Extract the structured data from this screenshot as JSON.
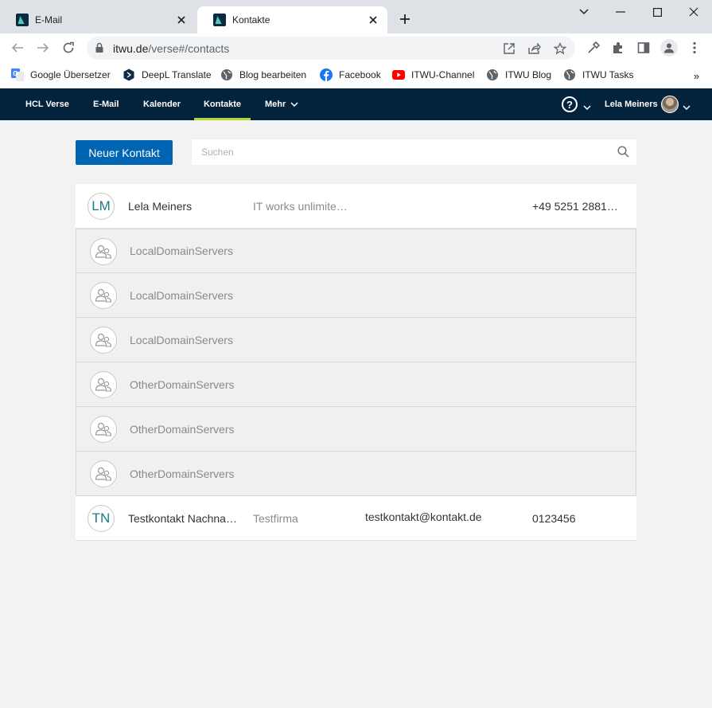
{
  "browser": {
    "tabs": [
      {
        "title": "E-Mail",
        "icon": "verse-favicon-icon",
        "active": false
      },
      {
        "title": "Kontakte",
        "icon": "verse-favicon-icon",
        "active": true
      }
    ],
    "url_host": "itwu.de",
    "url_path": "/verse#/contacts",
    "bookmarks": [
      {
        "label": "Google Übersetzer",
        "icon": "google-translate-icon"
      },
      {
        "label": "DeepL Translate",
        "icon": "deepl-icon"
      },
      {
        "label": "Blog bearbeiten",
        "icon": "globe-icon"
      },
      {
        "label": "Facebook",
        "icon": "facebook-icon"
      },
      {
        "label": "ITWU-Channel",
        "icon": "youtube-icon"
      },
      {
        "label": "ITWU Blog",
        "icon": "globe-icon"
      },
      {
        "label": "ITWU Tasks",
        "icon": "globe-icon"
      }
    ],
    "bookmarks_overflow": "»"
  },
  "app": {
    "nav": [
      {
        "label": "HCL Verse"
      },
      {
        "label": "E-Mail"
      },
      {
        "label": "Kalender"
      },
      {
        "label": "Kontakte",
        "active": true
      },
      {
        "label": "Mehr"
      }
    ],
    "help": "?",
    "user_name": "Lela Meiners",
    "accent_color": "#b5d334",
    "header_color": "#03223c"
  },
  "contacts": {
    "new_button": "Neuer Kontakt",
    "search_placeholder": "Suchen",
    "rows": [
      {
        "type": "person",
        "initials": "LM",
        "name": "Lela Meiners",
        "company": "IT works unlimite…",
        "email": "",
        "phone": "+49 5251 2881…"
      },
      {
        "type": "group",
        "name": "LocalDomainServers"
      },
      {
        "type": "group",
        "name": "LocalDomainServers"
      },
      {
        "type": "group",
        "name": "LocalDomainServers"
      },
      {
        "type": "group",
        "name": "OtherDomainServers"
      },
      {
        "type": "group",
        "name": "OtherDomainServers"
      },
      {
        "type": "group",
        "name": "OtherDomainServers"
      },
      {
        "type": "person",
        "initials": "TN",
        "name": "Testkontakt Nachna…",
        "company": "Testfirma",
        "email": "testkontakt@kontakt.de",
        "phone": "0123456"
      }
    ]
  }
}
